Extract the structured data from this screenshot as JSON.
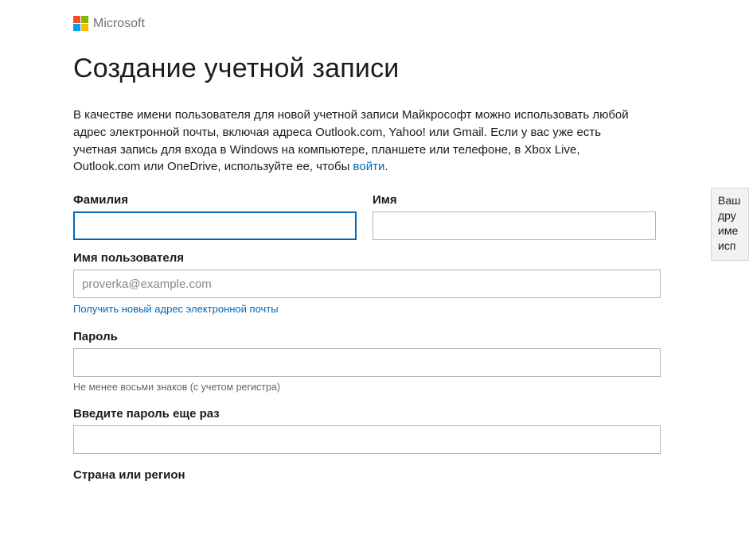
{
  "header": {
    "brand": "Microsoft"
  },
  "title": "Создание учетной записи",
  "intro_text_before_link": "В качестве имени пользователя для новой учетной записи Майкрософт можно использовать любой адрес электронной почты, включая адреса Outlook.com, Yahoo! или Gmail. Если у вас уже есть учетная запись для входа в Windows на компьютере, планшете или телефоне, в Xbox Live, Outlook.com или OneDrive, используйте ее, чтобы ",
  "intro_link": "войти",
  "intro_after": ".",
  "fields": {
    "lastname": {
      "label": "Фамилия",
      "value": ""
    },
    "firstname": {
      "label": "Имя",
      "value": ""
    },
    "username": {
      "label": "Имя пользователя",
      "placeholder": "proverka@example.com",
      "value": ""
    },
    "new_email_link": "Получить новый адрес электронной почты",
    "password": {
      "label": "Пароль",
      "value": "",
      "hint": "Не менее восьми знаков (с учетом регистра)"
    },
    "password2": {
      "label": "Введите пароль еще раз",
      "value": ""
    },
    "country": {
      "label": "Страна или регион"
    }
  },
  "tooltip_lines": [
    "Ваш",
    "дру",
    "име",
    "исп"
  ]
}
